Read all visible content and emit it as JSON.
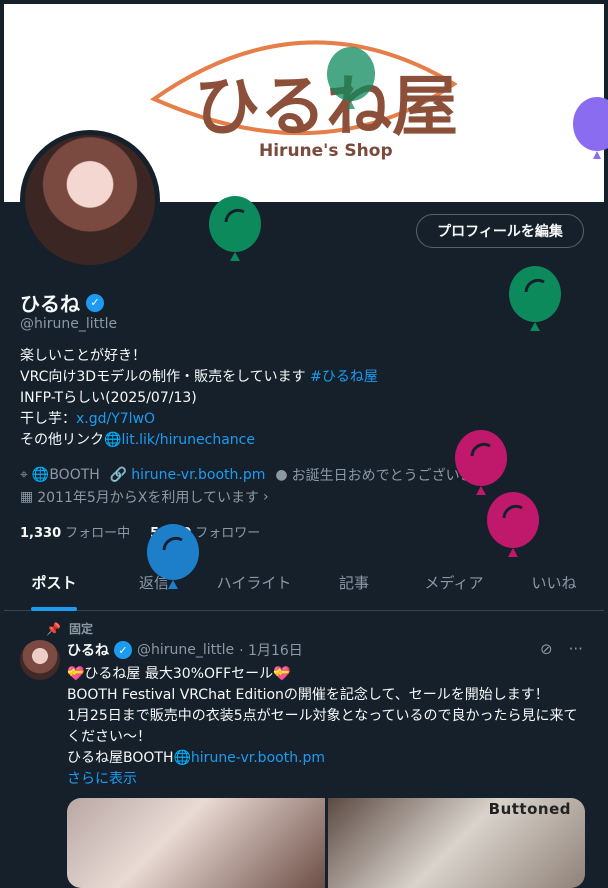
{
  "banner": {
    "logo_text": "ひるね屋",
    "logo_subtitle": "Hirune's Shop"
  },
  "profile": {
    "edit_button": "プロフィールを編集",
    "name": "ひるね",
    "handle": "@hirune_little",
    "bio": {
      "line1": "楽しいことが好き！",
      "line2_text": "VRC向け3Dモデルの制作・販売をしています",
      "line2_tag": "#ひるね屋",
      "line3": "INFP-Tらしい(2025/07/13)",
      "line4_text": "干し芋：",
      "line4_link": "x.gd/Y7lwO",
      "line5_text": "その他リンク🌐",
      "line5_link": "lit.lik/hirunechance"
    },
    "meta": {
      "location": "🌐BOOTH",
      "website": "hirune-vr.booth.pm",
      "birthday": "お誕生日おめでとうございます。",
      "joined": "2011年5月からXを利用しています"
    },
    "following_count": "1,330",
    "following_label": "フォロー中",
    "followers_count": "5,240",
    "followers_label": "フォロワー"
  },
  "tabs": [
    "ポスト",
    "返信",
    "ハイライト",
    "記事",
    "メディア",
    "いいね"
  ],
  "pinned_tweet": {
    "pinned_label": "固定",
    "name": "ひるね",
    "handle": "@hirune_little",
    "date": "· 1月16日",
    "line1": "💝ひるね屋 最大30%OFFセール💝",
    "line2": "BOOTH Festival VRChat Editionの開催を記念して、セールを開始します！",
    "line3": "1月25日まで販売中の衣装5点がセール対象となっているので良かったら見に来てください～！",
    "line4_text": "ひるね屋BOOTH🌐",
    "line4_link": "hirune-vr.booth.pm",
    "show_more": "さらに表示",
    "media_caption": "Buttoned"
  },
  "colors": {
    "accent": "#1d9bf0",
    "background": "#15202b",
    "balloon_green": "#0d8a5c",
    "balloon_pink": "#c0186a",
    "balloon_blue": "#1d7fc9",
    "balloon_purple": "#8a6cf0"
  }
}
